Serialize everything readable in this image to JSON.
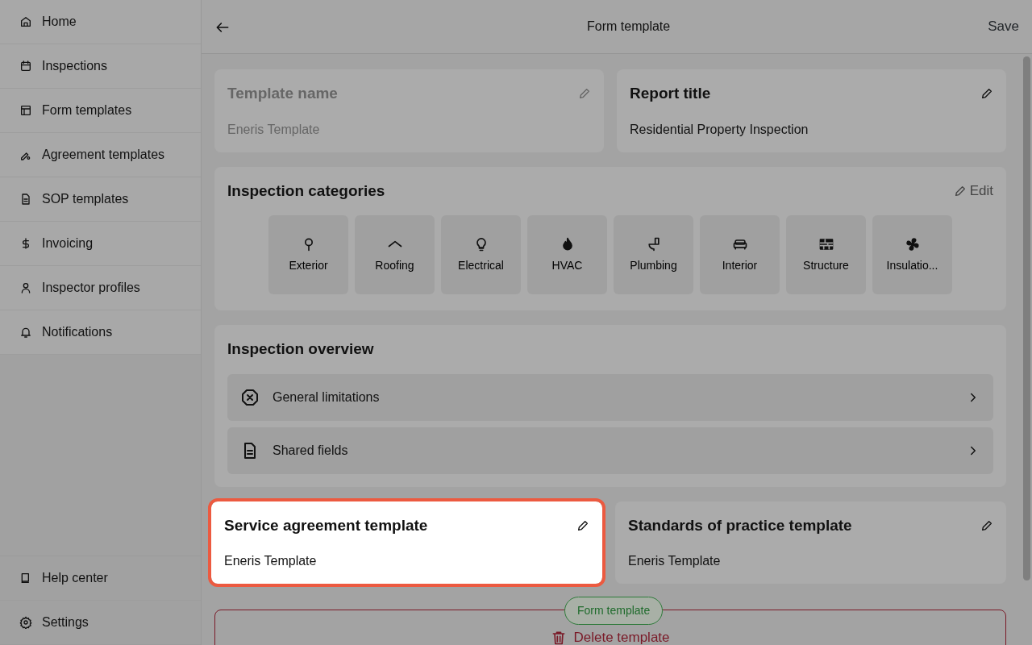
{
  "sidebar": {
    "items": [
      {
        "label": "Home"
      },
      {
        "label": "Inspections"
      },
      {
        "label": "Form templates"
      },
      {
        "label": "Agreement templates"
      },
      {
        "label": "SOP templates"
      },
      {
        "label": "Invoicing"
      },
      {
        "label": "Inspector profiles"
      },
      {
        "label": "Notifications"
      }
    ],
    "footer_items": [
      {
        "label": "Help center"
      },
      {
        "label": "Settings"
      }
    ]
  },
  "header": {
    "title": "Form template",
    "action": "Save"
  },
  "top_cards": [
    {
      "title": "Template name",
      "value": "Eneris Template",
      "disabled": true
    },
    {
      "title": "Report title",
      "value": "Residential Property Inspection",
      "disabled": false
    }
  ],
  "categories": {
    "title": "Inspection categories",
    "edit": "Edit",
    "items": [
      {
        "label": "Exterior"
      },
      {
        "label": "Roofing"
      },
      {
        "label": "Electrical"
      },
      {
        "label": "HVAC"
      },
      {
        "label": "Plumbing"
      },
      {
        "label": "Interior"
      },
      {
        "label": "Structure"
      },
      {
        "label": "Insulatio..."
      }
    ]
  },
  "overview": {
    "title": "Inspection overview",
    "rows": [
      {
        "label": "General limitations"
      },
      {
        "label": "Shared fields"
      }
    ]
  },
  "bottom_cards": [
    {
      "title": "Service agreement template",
      "value": "Eneris Template",
      "highlighted": true
    },
    {
      "title": "Standards of practice template",
      "value": "Eneris Template",
      "highlighted": false
    }
  ],
  "delete_button": "Delete template",
  "tooltip": "Form template"
}
